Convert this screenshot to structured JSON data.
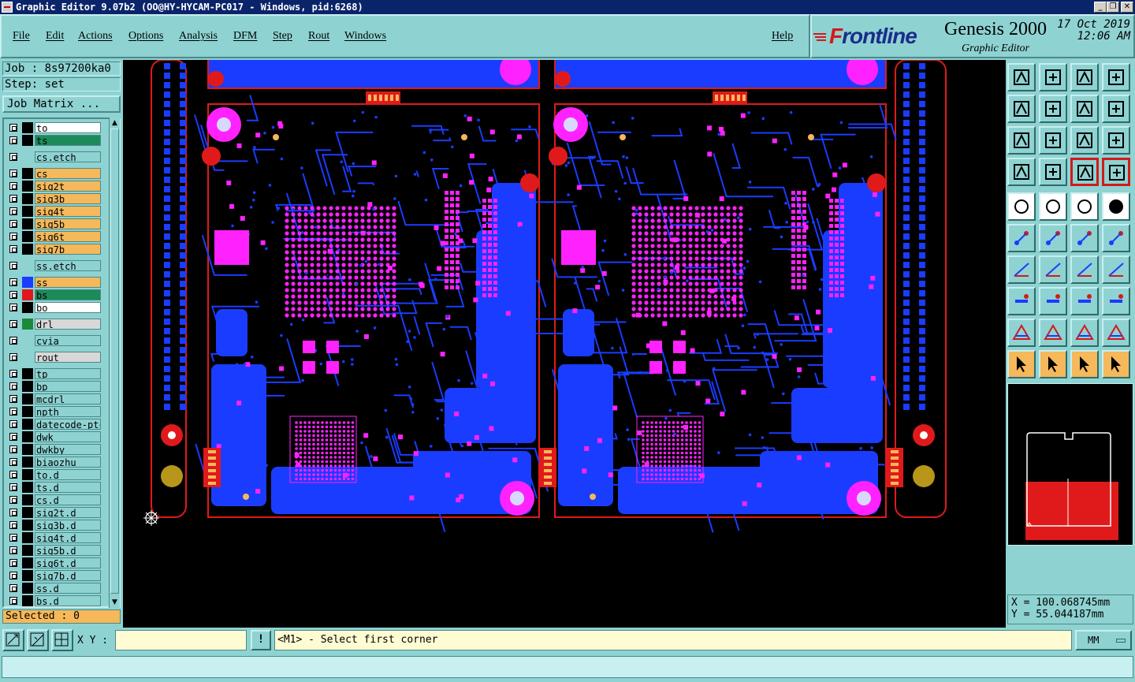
{
  "window": {
    "title": "Graphic Editor 9.07b2 (OO@HY-HYCAM-PC017 - Windows, pid:6268)",
    "controls": [
      "_",
      "❐",
      "✕"
    ]
  },
  "menu": [
    "File",
    "Edit",
    "Actions",
    "Options",
    "Analysis",
    "DFM",
    "Step",
    "Rout",
    "Windows",
    "Help"
  ],
  "brand": {
    "logo_prefix": "F",
    "logo_rest": "rontline",
    "product": "Genesis 2000",
    "subtitle": "Graphic Editor",
    "date": "17 Oct 2019",
    "time": "12:06 AM"
  },
  "job": {
    "job_label": "Job : 8s97200ka0",
    "step_label": "Step: set",
    "matrix_button": "Job Matrix ..."
  },
  "layers": [
    {
      "name": "to",
      "bg": "white",
      "swatch": "#000000"
    },
    {
      "name": "ts",
      "bg": "green",
      "swatch": "#000000"
    },
    {
      "name": "cs.etch",
      "bg": "cyan",
      "swatch": "none"
    },
    {
      "name": "cs",
      "bg": "orange",
      "swatch": "#000000"
    },
    {
      "name": "sig2t",
      "bg": "orange",
      "swatch": "#000000"
    },
    {
      "name": "sig3b",
      "bg": "orange",
      "swatch": "#000000"
    },
    {
      "name": "sig4t",
      "bg": "orange",
      "swatch": "#000000"
    },
    {
      "name": "sig5b",
      "bg": "orange",
      "swatch": "#000000"
    },
    {
      "name": "sig6t",
      "bg": "orange",
      "swatch": "#000000"
    },
    {
      "name": "sig7b",
      "bg": "orange",
      "swatch": "#000000"
    },
    {
      "name": "ss.etch",
      "bg": "cyan",
      "swatch": "none"
    },
    {
      "name": "ss",
      "bg": "orange",
      "swatch": "#1a3cff"
    },
    {
      "name": "bs",
      "bg": "green",
      "swatch": "#e01a1a"
    },
    {
      "name": "bo",
      "bg": "white",
      "swatch": "#000000"
    },
    {
      "name": "drl",
      "bg": "grey",
      "swatch": "#1a8a3a"
    },
    {
      "name": "cvia",
      "bg": "cyan",
      "swatch": "none"
    },
    {
      "name": "rout",
      "bg": "grey",
      "swatch": "none"
    },
    {
      "name": "tp",
      "bg": "cyan",
      "swatch": "#000000"
    },
    {
      "name": "bp",
      "bg": "cyan",
      "swatch": "#000000"
    },
    {
      "name": "mcdrl",
      "bg": "cyan",
      "swatch": "#000000"
    },
    {
      "name": "npth",
      "bg": "cyan",
      "swatch": "#000000"
    },
    {
      "name": "datecode-ptc",
      "bg": "cyan",
      "swatch": "#000000"
    },
    {
      "name": "dwk",
      "bg": "cyan",
      "swatch": "#000000"
    },
    {
      "name": "dwkby",
      "bg": "cyan",
      "swatch": "#000000"
    },
    {
      "name": "biaozhu",
      "bg": "cyan",
      "swatch": "#000000"
    },
    {
      "name": "to.d",
      "bg": "cyan",
      "swatch": "#000000"
    },
    {
      "name": "ts.d",
      "bg": "cyan",
      "swatch": "#000000"
    },
    {
      "name": "cs.d",
      "bg": "cyan",
      "swatch": "#000000"
    },
    {
      "name": "sig2t.d",
      "bg": "cyan",
      "swatch": "#000000"
    },
    {
      "name": "sig3b.d",
      "bg": "cyan",
      "swatch": "#000000"
    },
    {
      "name": "sig4t.d",
      "bg": "cyan",
      "swatch": "#000000"
    },
    {
      "name": "sig5b.d",
      "bg": "cyan",
      "swatch": "#000000"
    },
    {
      "name": "sig6t.d",
      "bg": "cyan",
      "swatch": "#000000"
    },
    {
      "name": "sig7b.d",
      "bg": "cyan",
      "swatch": "#000000"
    },
    {
      "name": "ss.d",
      "bg": "cyan",
      "swatch": "#000000"
    },
    {
      "name": "bs.d",
      "bg": "cyan",
      "swatch": "#000000"
    }
  ],
  "selected": "Selected : 0",
  "coords": {
    "x": "X = 100.068745mm",
    "y": "Y = 55.044187mm"
  },
  "bottom": {
    "xy_label": "X Y :",
    "xy_value": "",
    "bang": "!",
    "prompt": "<M1> - Select first corner",
    "units": "MM"
  },
  "colors": {
    "panel": "#8fd2d2",
    "canvas": "#000000",
    "copper": "#1a3cff",
    "pad": "#ff22ff",
    "outline": "#e01a1a",
    "highlight": "#f5b85a"
  }
}
